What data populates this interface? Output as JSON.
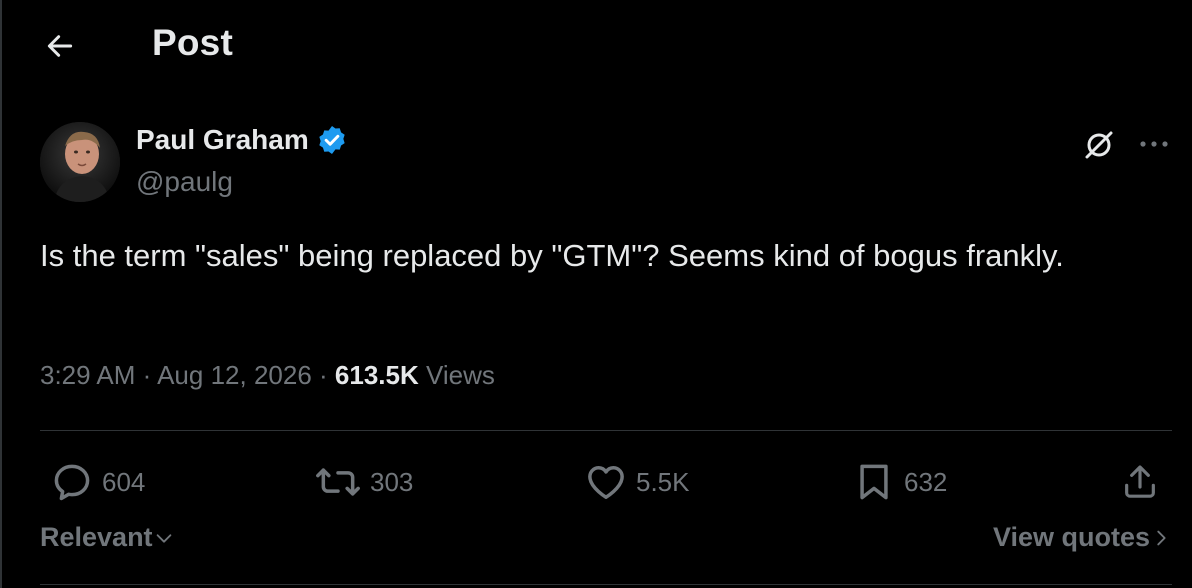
{
  "header": {
    "title": "Post",
    "back_icon": "arrow-left-icon"
  },
  "author": {
    "display_name": "Paul Graham",
    "handle": "@paulg",
    "verified": true,
    "verified_color": "#1d9bf0"
  },
  "post": {
    "text": "Is the term \"sales\" being replaced by \"GTM\"? Seems kind of bogus frankly.",
    "time": "3:29 AM",
    "date": "Aug 12, 2026",
    "views_count": "613.5K",
    "views_label": "Views"
  },
  "actions": {
    "replies": "604",
    "reposts": "303",
    "likes": "5.5K",
    "bookmarks": "632"
  },
  "filter": {
    "sort_label": "Relevant",
    "view_quotes_label": "View quotes"
  },
  "colors": {
    "background": "#000000",
    "primary_text": "#e7e9ea",
    "secondary_text": "#71767b",
    "divider": "#2f3336"
  }
}
